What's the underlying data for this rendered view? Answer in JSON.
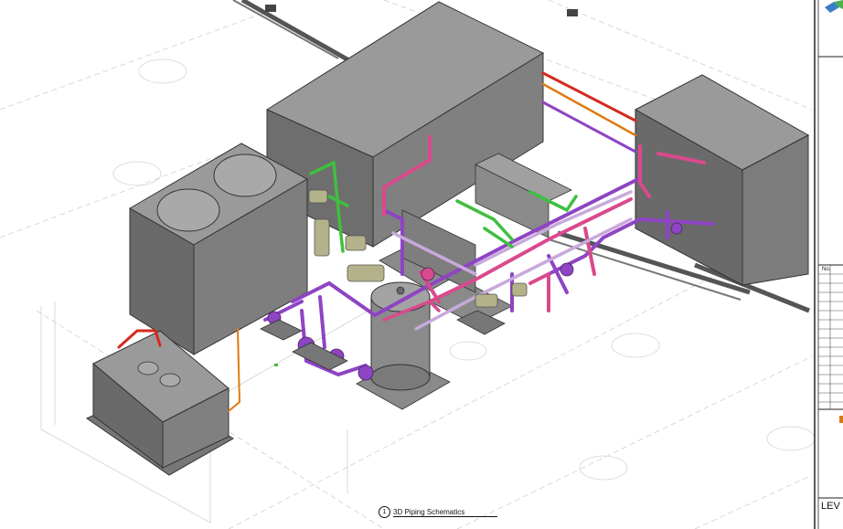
{
  "view_title": {
    "number": "1",
    "name": "3D Piping Schematics"
  },
  "title_block": {
    "revision_header": "No.",
    "sheet_label": "LEV"
  },
  "icons": [
    "logo-icon"
  ],
  "colors": {
    "equipment_gray": "#8a8a8a",
    "chilled_water_purple": "#8e44c4",
    "condenser_pink": "#d94a8c",
    "refrigerant_green": "#3fbf3f",
    "hot_water_red": "#d42a1e",
    "return_orange": "#e07a10",
    "valve_olive": "#b4b28a"
  }
}
